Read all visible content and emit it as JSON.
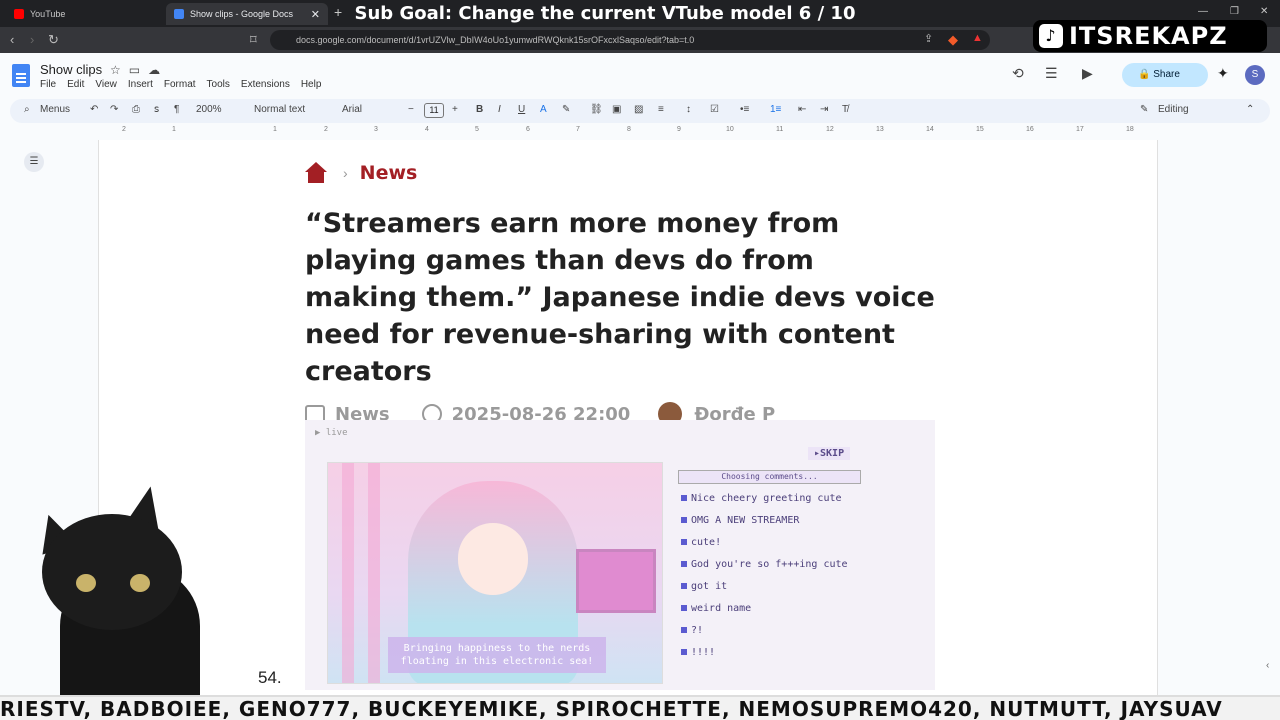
{
  "browser": {
    "tabs": [
      {
        "label": "YouTube",
        "favicon_color": "#ff0000"
      },
      {
        "label": "Show clips - Google Docs",
        "favicon_color": "#4285f4"
      }
    ],
    "url": "docs.google.com/document/d/1vrUZVlw_DbIW4oUo1yumwdRWQknk15srOFxcxlSaqso/edit?tab=t.0"
  },
  "overlay": {
    "goal": "Sub Goal: Change the current VTube model  6 / 10",
    "tiktok_handle": "ITSREKAPZ",
    "ticker": "RIESTV, BADBOIEE, GENO777, BUCKEYEMIKE, SPIROCHETTE, NEMOSUPREMO420, NUTMUTT, JAYSUAV"
  },
  "docs": {
    "title": "Show clips",
    "menu": [
      "File",
      "Edit",
      "View",
      "Insert",
      "Format",
      "Tools",
      "Extensions",
      "Help"
    ],
    "share_label": "Share",
    "avatar_letter": "S",
    "toolbar": {
      "menus_label": "Menus",
      "zoom": "200%",
      "style": "Normal text",
      "font": "Arial",
      "font_size": "11",
      "mode": "Editing"
    },
    "ruler_ticks": [
      "2",
      "1",
      "1",
      "2",
      "3",
      "4",
      "5",
      "6",
      "7",
      "8",
      "9",
      "10",
      "11",
      "12",
      "13",
      "14",
      "15",
      "16",
      "17",
      "18"
    ],
    "page_number": "54."
  },
  "article": {
    "breadcrumb": "News",
    "headline": "“Streamers earn more money from playing games than devs do from making them.” Japanese indie devs voice need for revenue-sharing with content creators",
    "category": "News",
    "datetime": "2025-08-26 22:00",
    "author": "Đorđe P"
  },
  "game": {
    "live_label": "▶ live",
    "skip_label": "▸SKIP",
    "choosing_label": "Choosing comments...",
    "comments": [
      "Nice cheery greeting cute",
      "OMG A NEW STREAMER",
      "cute!",
      "God you're so f+++ing cute",
      "got it",
      "weird name",
      "?!",
      "!!!!"
    ],
    "caption": "Bringing happiness to the nerds floating in this electronic sea!"
  }
}
